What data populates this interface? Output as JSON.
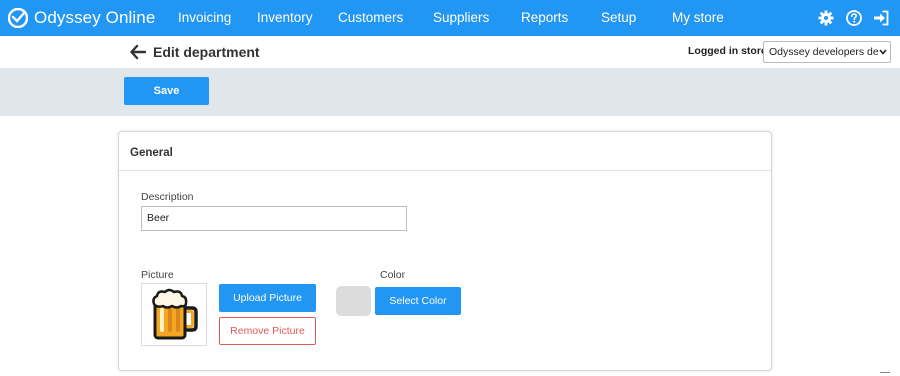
{
  "app": {
    "brand": "Odyssey Online",
    "brand_icon": "odyssey-logo-icon"
  },
  "nav": {
    "items": [
      {
        "label": "Invoicing"
      },
      {
        "label": "Inventory"
      },
      {
        "label": "Customers"
      },
      {
        "label": "Suppliers"
      },
      {
        "label": "Reports"
      },
      {
        "label": "Setup"
      },
      {
        "label": "My store"
      }
    ],
    "icons": [
      "gear-icon",
      "help-icon",
      "sign-in-icon"
    ]
  },
  "header": {
    "title": "Edit department",
    "logged_in_label": "Logged in store",
    "store_value": "Odyssey developers de"
  },
  "toolbar": {
    "save_label": "Save"
  },
  "card": {
    "title": "General",
    "description_label": "Description",
    "description_value": "Beer",
    "picture_label": "Picture",
    "picture_icon": "beer-mug-icon",
    "upload_label": "Upload Picture",
    "remove_label": "Remove Picture",
    "color_label": "Color",
    "select_color_label": "Select Color",
    "color_value": "#dcdcdc"
  },
  "colors": {
    "primary": "#2196f3",
    "toolbar_bg": "#e1e6ea",
    "danger": "#e05a5a"
  }
}
